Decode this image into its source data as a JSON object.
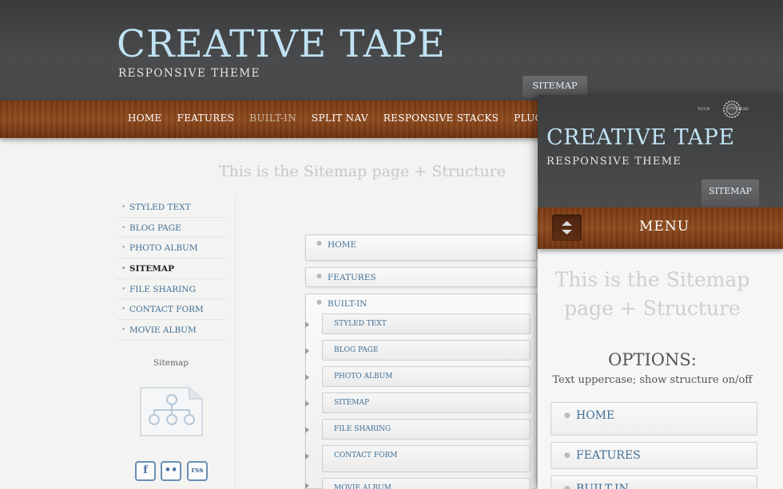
{
  "site": {
    "brand": "CREATIVE TAPE",
    "tagline": "RESPONSIVE THEME",
    "sitemap_tab": "SITEMAP"
  },
  "nav": {
    "items": [
      "HOME",
      "FEATURES",
      "BUILT-IN",
      "SPLIT NAV",
      "RESPONSIVE STACKS",
      "PLUGINS"
    ],
    "active": "BUILT-IN"
  },
  "page": {
    "title": "This is the Sitemap page + Structure"
  },
  "sidebar": {
    "items": [
      "STYLED TEXT",
      "BLOG PAGE",
      "PHOTO ALBUM",
      "SITEMAP",
      "FILE SHARING",
      "CONTACT FORM",
      "MOVIE ALBUM"
    ],
    "current": "SITEMAP",
    "widget_title": "Sitemap",
    "social": [
      "f",
      "••",
      "rss"
    ]
  },
  "sitemap": {
    "top": [
      "HOME",
      "FEATURES",
      "BUILT-IN"
    ],
    "children": [
      "STYLED TEXT",
      "BLOG PAGE",
      "PHOTO ALBUM",
      "SITEMAP",
      "FILE SHARING",
      "CONTACT FORM",
      "MOVIE ALBUM"
    ]
  },
  "mobile": {
    "logo_left": "YOUR",
    "logo_center": "LOGO",
    "logo_right": "HERE",
    "brand": "CREATIVE TAPE",
    "tagline": "RESPONSIVE THEME",
    "sitemap_tab": "SITEMAP",
    "menu_label": "MENU",
    "title": "This is the Sitemap page + Structure",
    "options_heading": "OPTIONS:",
    "options_desc": "Text uppercase; show structure on/off",
    "items": [
      "HOME",
      "FEATURES",
      "BUILT-IN"
    ]
  },
  "colors": {
    "brand_blue": "#bfe2f3",
    "link_blue": "#3f6f96",
    "wood": "#8e4a1e",
    "header_dark": "#434445"
  }
}
